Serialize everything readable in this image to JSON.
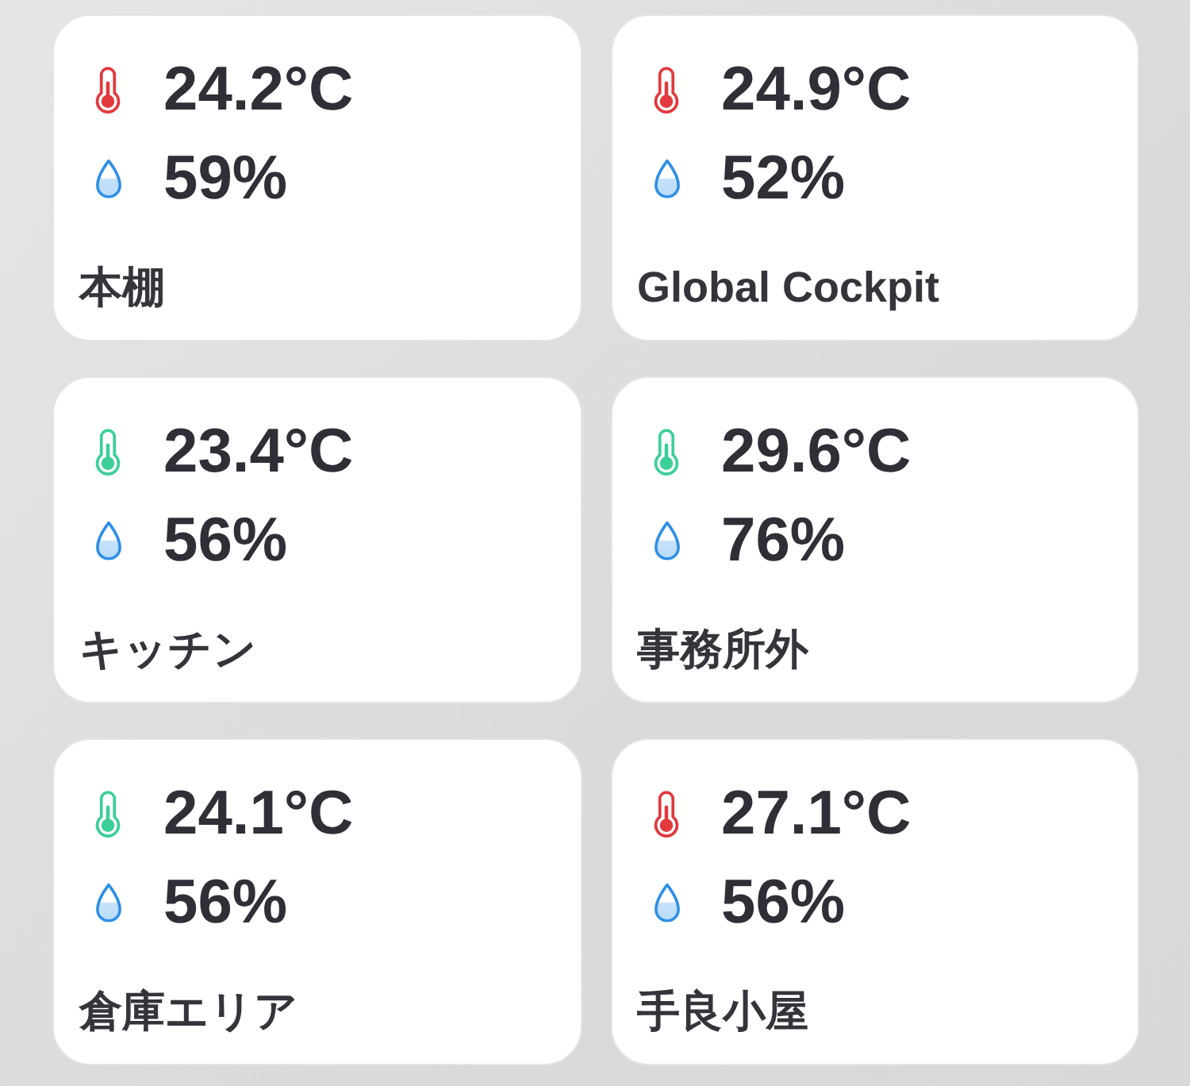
{
  "sensors": [
    {
      "temperature": "24.2°C",
      "humidity": "59%",
      "name": "本棚",
      "color": "#e1393d"
    },
    {
      "temperature": "24.9°C",
      "humidity": "52%",
      "name": "Global Cockpit",
      "color": "#e1393d"
    },
    {
      "temperature": "23.4°C",
      "humidity": "56%",
      "name": "キッチン",
      "color": "#3ccf98"
    },
    {
      "temperature": "29.6°C",
      "humidity": "76%",
      "name": "事務所外",
      "color": "#3ccf98"
    },
    {
      "temperature": "24.1°C",
      "humidity": "56%",
      "name": "倉庫エリア",
      "color": "#3ccf98"
    },
    {
      "temperature": "27.1°C",
      "humidity": "56%",
      "name": "手良小屋",
      "color": "#e1393d"
    }
  ]
}
